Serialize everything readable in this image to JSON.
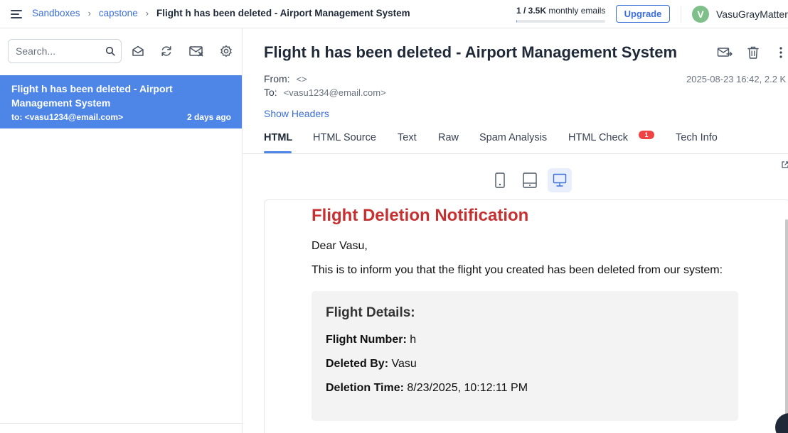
{
  "breadcrumb": {
    "items": [
      "Sandboxes",
      "capstone"
    ],
    "current": "Flight h has been deleted - Airport Management System",
    "separator": "›"
  },
  "quota": {
    "used": "1 / 3.5K",
    "label": "monthly emails",
    "fraction": 0.0003
  },
  "account": {
    "upgrade_label": "Upgrade",
    "avatar_initial": "V",
    "username": "VasuGrayMatter",
    "avatar_color": "#7fbf8a"
  },
  "search": {
    "placeholder": "Search..."
  },
  "toolbar_icons": [
    "mark-read-icon",
    "refresh-icon",
    "clear-inbox-icon",
    "settings-icon"
  ],
  "messages": [
    {
      "subject": "Flight h has been deleted - Airport Management System",
      "to": "to: <vasu1234@email.com>",
      "time": "2 days ago",
      "selected": true
    }
  ],
  "email": {
    "title": "Flight h has been deleted - Airport Management System",
    "from_label": "From:",
    "from_value": "<>",
    "to_label": "To:",
    "to_value": "<vasu1234@email.com>",
    "date_size": "2025-08-23 16:42, 2.2 K",
    "show_headers": "Show Headers"
  },
  "tabs": [
    {
      "label": "HTML",
      "active": true
    },
    {
      "label": "HTML Source",
      "active": false
    },
    {
      "label": "Text",
      "active": false
    },
    {
      "label": "Raw",
      "active": false
    },
    {
      "label": "Spam Analysis",
      "active": false
    },
    {
      "label": "HTML Check",
      "active": false,
      "badge": "1"
    },
    {
      "label": "Tech Info",
      "active": false
    }
  ],
  "device_views": [
    "mobile-icon",
    "tablet-icon",
    "desktop-icon"
  ],
  "active_device": "desktop",
  "preview": {
    "heading": "Flight Deletion Notification",
    "greeting": "Dear Vasu,",
    "intro": "This is to inform you that the flight you created has been deleted from our system:",
    "details_title": "Flight Details:",
    "flight_number_label": "Flight Number:",
    "flight_number": "h",
    "deleted_by_label": "Deleted By:",
    "deleted_by": "Vasu",
    "deletion_time_label": "Deletion Time:",
    "deletion_time": "8/23/2025, 10:12:11 PM"
  },
  "colors": {
    "accent": "#4e86e8",
    "link": "#3b6fd8",
    "heading_red": "#c53030",
    "badge_red": "#ef4444"
  }
}
